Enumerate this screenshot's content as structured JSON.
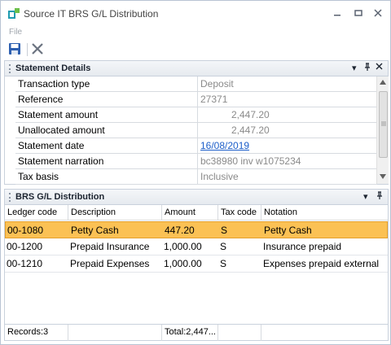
{
  "window": {
    "title": "Source IT BRS G/L Distribution",
    "icon": "app-icon"
  },
  "menu": {
    "file": "File"
  },
  "toolbar": {
    "save_icon": "save-icon",
    "delete_icon": "delete-icon"
  },
  "statement_panel": {
    "title": "Statement Details",
    "rows": [
      {
        "label": "Transaction type",
        "value": "Deposit"
      },
      {
        "label": "Reference",
        "value": "27371"
      },
      {
        "label": "Statement amount",
        "value": "2,447.20"
      },
      {
        "label": "Unallocated amount",
        "value": "2,447.20"
      },
      {
        "label": "Statement date",
        "value": "16/08/2019"
      },
      {
        "label": "Statement narration",
        "value": "bc38980 inv w1075234"
      },
      {
        "label": "Tax basis",
        "value": "Inclusive"
      }
    ]
  },
  "distribution_panel": {
    "title": "BRS G/L Distribution",
    "columns": [
      "Ledger code",
      "Description",
      "Amount",
      "Tax code",
      "Notation"
    ],
    "rows": [
      {
        "ledger_code": "00-1080",
        "description": "Petty Cash",
        "amount": "447.20",
        "tax_code": "S",
        "notation": "Petty Cash"
      },
      {
        "ledger_code": "00-1200",
        "description": "Prepaid Insurance",
        "amount": "1,000.00",
        "tax_code": "S",
        "notation": "Insurance prepaid"
      },
      {
        "ledger_code": "00-1210",
        "description": "Prepaid Expenses",
        "amount": "1,000.00",
        "tax_code": "S",
        "notation": "Expenses prepaid external"
      }
    ],
    "status": {
      "records": "Records:3",
      "total": "Total:2,447..."
    }
  },
  "colors": {
    "selected_row": "#fbc154",
    "link": "#1c5ec9",
    "accent": "#1aa3a3"
  }
}
